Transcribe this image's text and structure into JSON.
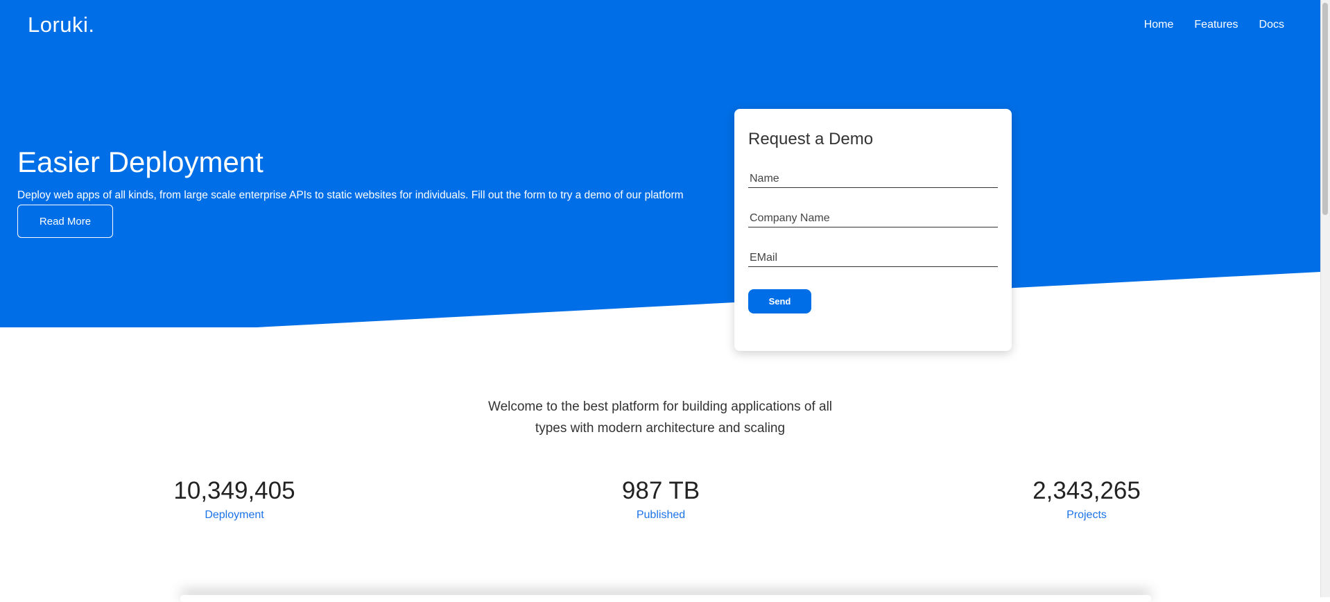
{
  "brand": {
    "name": "Loruki."
  },
  "nav": {
    "items": [
      "Home",
      "Features",
      "Docs"
    ]
  },
  "hero": {
    "title": "Easier Deployment",
    "text": "Deploy web apps of all kinds, from large scale enterprise APIs to static websites for individuals. Fill out the form to try a demo of our platform",
    "button_label": "Read More"
  },
  "demo_form": {
    "title": "Request a Demo",
    "name_placeholder": "Name",
    "company_placeholder": "Company Name",
    "email_placeholder": "EMail",
    "send_label": "Send"
  },
  "welcome": {
    "text": "Welcome to the best platform for building applications of all types with modern architecture and scaling"
  },
  "stats": [
    {
      "value": "10,349,405",
      "label": "Deployment"
    },
    {
      "value": "987 TB",
      "label": "Published"
    },
    {
      "value": "2,343,265",
      "label": "Projects"
    }
  ],
  "colors": {
    "primary": "#006ee6",
    "link": "#1a73e8"
  }
}
